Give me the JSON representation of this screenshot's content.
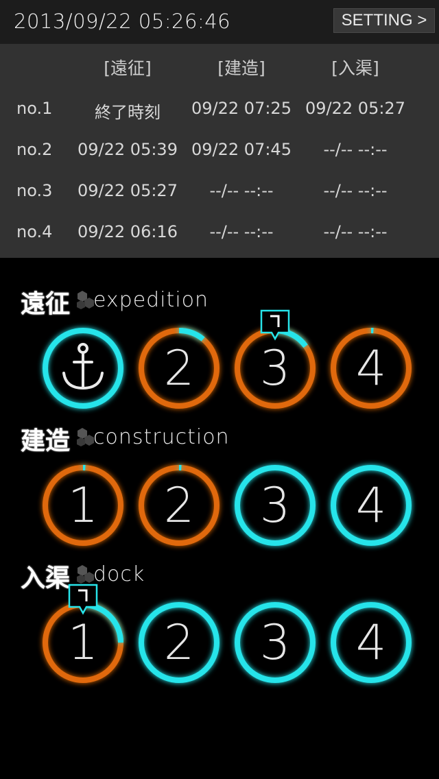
{
  "header": {
    "datetime": "2013/09/22 05:26:46",
    "setting_label": "SETTING >"
  },
  "table": {
    "columns": [
      "[遠征]",
      "[建造]",
      "[入渠]"
    ],
    "rows": [
      {
        "label": "no.1",
        "values": [
          "終了時刻",
          "09/22 07:25",
          "09/22 05:27"
        ]
      },
      {
        "label": "no.2",
        "values": [
          "09/22 05:39",
          "09/22 07:45",
          "--/-- --:--"
        ]
      },
      {
        "label": "no.3",
        "values": [
          "09/22 05:27",
          "--/-- --:--",
          "--/-- --:--"
        ]
      },
      {
        "label": "no.4",
        "values": [
          "09/22 06:16",
          "--/-- --:--",
          "--/-- --:--"
        ]
      }
    ]
  },
  "colors": {
    "cyan": "#27e4ea",
    "orange": "#e0690f",
    "table_bg": "#323232",
    "topbar_bg": "#1c1c1c"
  },
  "sections": [
    {
      "title_jp": "遠征",
      "title_en": "expedition",
      "slots": [
        {
          "label": "",
          "icon": "anchor-icon",
          "color": "cyan",
          "progress": 1.0,
          "badge": false
        },
        {
          "label": "2",
          "color": "orange",
          "progress": 0.11,
          "badge": false
        },
        {
          "label": "3",
          "color": "orange",
          "progress": 0.15,
          "badge": true
        },
        {
          "label": "4",
          "color": "orange",
          "progress": 0.01,
          "badge": false
        }
      ]
    },
    {
      "title_jp": "建造",
      "title_en": "construction",
      "slots": [
        {
          "label": "1",
          "color": "orange",
          "progress": 0.01,
          "badge": false
        },
        {
          "label": "2",
          "color": "orange",
          "progress": 0.01,
          "badge": false
        },
        {
          "label": "3",
          "color": "cyan",
          "progress": 1.0,
          "badge": false
        },
        {
          "label": "4",
          "color": "cyan",
          "progress": 1.0,
          "badge": false
        }
      ]
    },
    {
      "title_jp": "入渠",
      "title_en": "dock",
      "slots": [
        {
          "label": "1",
          "color": "orange",
          "progress": 0.25,
          "badge": true
        },
        {
          "label": "2",
          "color": "cyan",
          "progress": 1.0,
          "badge": false
        },
        {
          "label": "3",
          "color": "cyan",
          "progress": 1.0,
          "badge": false
        },
        {
          "label": "4",
          "color": "cyan",
          "progress": 1.0,
          "badge": false
        }
      ]
    }
  ]
}
